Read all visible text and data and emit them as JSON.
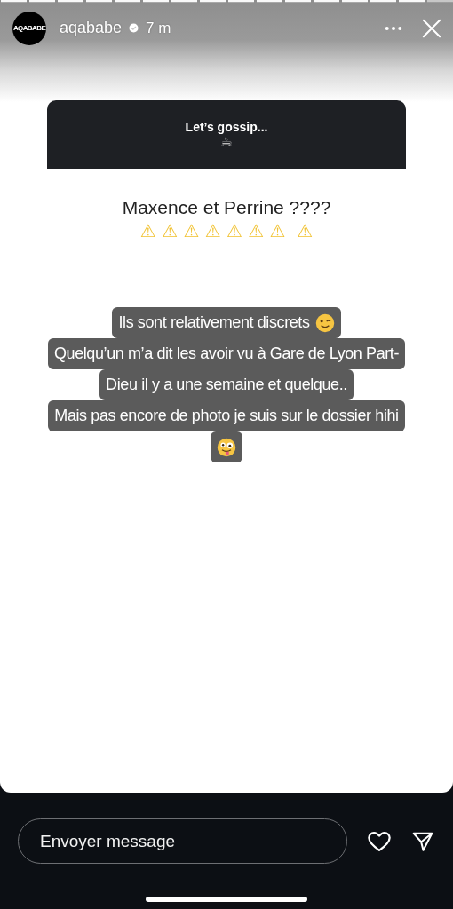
{
  "header": {
    "avatar_text": "AQABABE",
    "username": "aqababe",
    "verified": true,
    "time": "7 m"
  },
  "question_card": {
    "title": "Let’s gossip...",
    "emoji": "☕"
  },
  "heading": "Maxence et Perrine ????",
  "warnings": "⚠ ⚠ ⚠ ⚠ ⚠ ⚠ ⚠  ⚠",
  "caption_lines": [
    {
      "text": "Ils sont relativement discrets",
      "kind": "wink"
    },
    {
      "text": "Quelqu’un m’a dit les avoir vu à Gare de Lyon Part-"
    },
    {
      "text": "Dieu il y a une semaine et quelque.."
    },
    {
      "text": "Mais pas encore de photo je suis sur le dossier hihi"
    },
    {
      "kind": "silly"
    }
  ],
  "reply": {
    "placeholder": "Envoyer message"
  }
}
